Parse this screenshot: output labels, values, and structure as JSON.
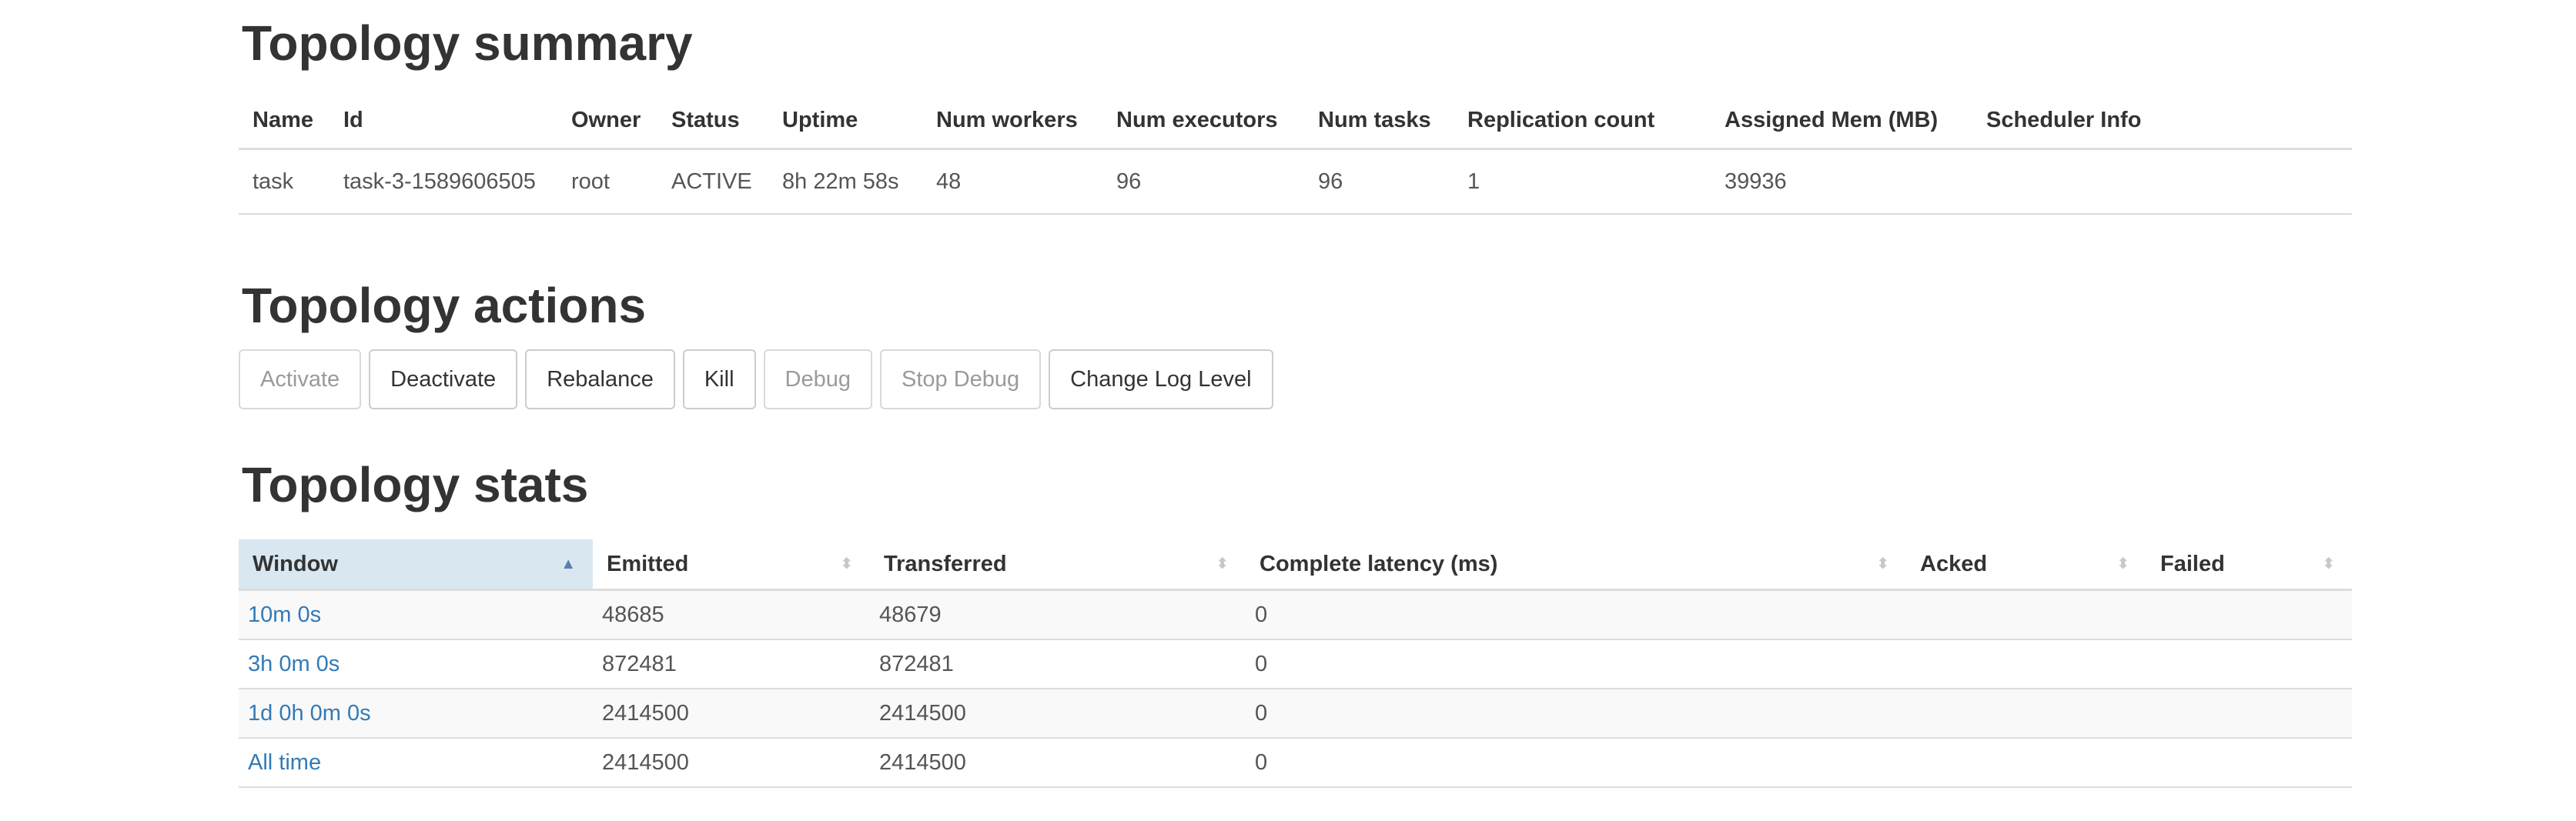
{
  "summary": {
    "title": "Topology summary",
    "headers": [
      "Name",
      "Id",
      "Owner",
      "Status",
      "Uptime",
      "Num workers",
      "Num executors",
      "Num tasks",
      "Replication count",
      "Assigned Mem (MB)",
      "Scheduler Info"
    ],
    "row": [
      "task",
      "task-3-1589606505",
      "root",
      "ACTIVE",
      "8h 22m 58s",
      "48",
      "96",
      "96",
      "1",
      "39936",
      ""
    ]
  },
  "actions": {
    "title": "Topology actions",
    "buttons": [
      {
        "label": "Activate",
        "enabled": false
      },
      {
        "label": "Deactivate",
        "enabled": true
      },
      {
        "label": "Rebalance",
        "enabled": true
      },
      {
        "label": "Kill",
        "enabled": true
      },
      {
        "label": "Debug",
        "enabled": false
      },
      {
        "label": "Stop Debug",
        "enabled": false
      },
      {
        "label": "Change Log Level",
        "enabled": true
      }
    ]
  },
  "stats": {
    "title": "Topology stats",
    "headers": [
      "Window",
      "Emitted",
      "Transferred",
      "Complete latency (ms)",
      "Acked",
      "Failed"
    ],
    "sorted_column": "Window",
    "sort_direction": "ascending",
    "rows": [
      [
        "10m 0s",
        "48685",
        "48679",
        "0",
        "",
        ""
      ],
      [
        "3h 0m 0s",
        "872481",
        "872481",
        "0",
        "",
        ""
      ],
      [
        "1d 0h 0m 0s",
        "2414500",
        "2414500",
        "0",
        "",
        ""
      ],
      [
        "All time",
        "2414500",
        "2414500",
        "0",
        "",
        ""
      ]
    ]
  },
  "colors": {
    "link": "#337ab7",
    "sorted_header_bg": "#d9e7f1",
    "border": "#dddddd",
    "stripe": "#f9f9f9"
  }
}
